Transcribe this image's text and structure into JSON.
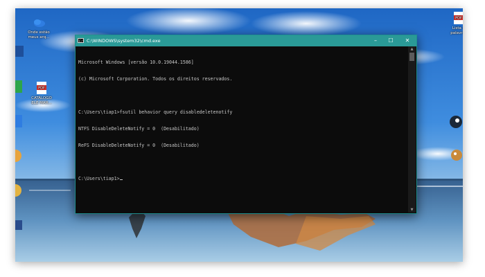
{
  "window": {
    "title": "C:\\WINDOWS\\system32\\cmd.exe",
    "controls": {
      "minimize": "–",
      "maximize": "☐",
      "close": "✕"
    }
  },
  "console": {
    "lines": [
      "Microsoft Windows [versão 10.0.19044.1586]",
      "(c) Microsoft Corporation. Todos os direitos reservados.",
      "",
      "C:\\Users\\tiap1>fsutil behavior query disabledeletenotify",
      "NTFS DisableDeleteNotify = 0  (Desabilitado)",
      "ReFS DisableDeleteNotify = 0  (Desabilitado)",
      "",
      "C:\\Users\\tiap1>"
    ]
  },
  "desktop": {
    "icons": [
      {
        "label": "Onde estão\nmeus arq..."
      },
      {
        "label": "CATÁLOGO\nELÉ MAR..."
      },
      {
        "label": "Lista d\npalavras"
      }
    ]
  },
  "colors": {
    "titlebar": "#2a9a97",
    "console_bg": "#0c0c0c",
    "console_text": "#c8c8c8"
  }
}
